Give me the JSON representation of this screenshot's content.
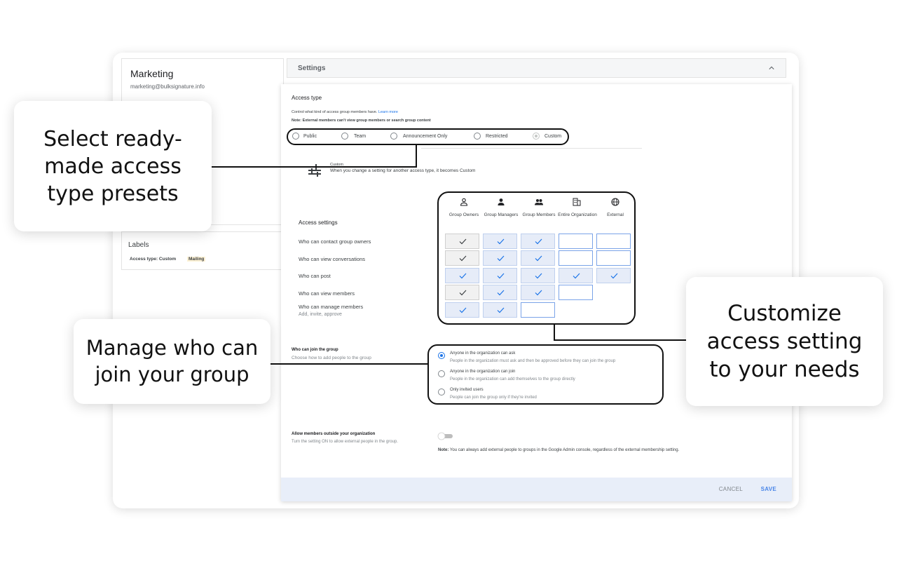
{
  "left_panel": {
    "group_name": "Marketing",
    "group_email": "marketing@bulksignature.info",
    "labels_title": "Labels",
    "label_chips": [
      "Access type: Custom",
      "Mailing"
    ]
  },
  "settings": {
    "title": "Settings",
    "access_type_title": "Access type",
    "desc_prefix": "Control what kind of access group members have.",
    "learn_more": "Learn more",
    "note": "Note: External members can't view group members or search group content",
    "presets": [
      "Public",
      "Team",
      "Announcement Only",
      "Restricted",
      "Custom"
    ],
    "selected_preset": "Custom",
    "custom_title": "Custom",
    "custom_desc": "When you change a setting for another access type, it becomes Custom",
    "access_settings_title": "Access settings",
    "columns": [
      {
        "label": "Group Owners",
        "icon": "person-outline-icon"
      },
      {
        "label": "Group Managers",
        "icon": "person-icon"
      },
      {
        "label": "Group Members",
        "icon": "people-icon"
      },
      {
        "label": "Entire Organization",
        "icon": "domain-icon"
      },
      {
        "label": "External",
        "icon": "globe-icon"
      }
    ],
    "rows": [
      {
        "label": "Who can contact group owners",
        "sub": ""
      },
      {
        "label": "Who can view conversations",
        "sub": ""
      },
      {
        "label": "Who can post",
        "sub": ""
      },
      {
        "label": "Who can view members",
        "sub": ""
      },
      {
        "label": "Who can manage members",
        "sub": "Add, invite, approve"
      }
    ],
    "join_title": "Who can join the group",
    "join_desc": "Choose how to add people to the group",
    "join_options": [
      {
        "label": "Anyone in the organization can ask",
        "sub": "People in the organization must ask and then be approved before they can join the group"
      },
      {
        "label": "Anyone in the organization can join",
        "sub": "People in the organization can add themselves to the group directly"
      },
      {
        "label": "Only invited users",
        "sub": "People can join the group only if they're invited"
      }
    ],
    "selected_join": "Anyone in the organization can ask",
    "external_title": "Allow members outside your organization",
    "external_desc": "Turn the setting ON to allow external people in the group.",
    "external_allowed": false,
    "external_note_bold": "Note:",
    "external_note": "You can always add external people to groups in the Google Admin console, regardless of the external membership setting.",
    "cancel": "CANCEL",
    "save": "SAVE"
  },
  "callouts": {
    "presets": "Select ready-\nmade access\ntype presets",
    "join": "Manage who can\njoin your group",
    "customize": "Customize\naccess setting\nto your needs"
  },
  "colors": {
    "accent": "#1a73e8",
    "save": "#4a86e8",
    "footer_bg": "#e8eef9",
    "cell_on": "#e6ecf8"
  }
}
